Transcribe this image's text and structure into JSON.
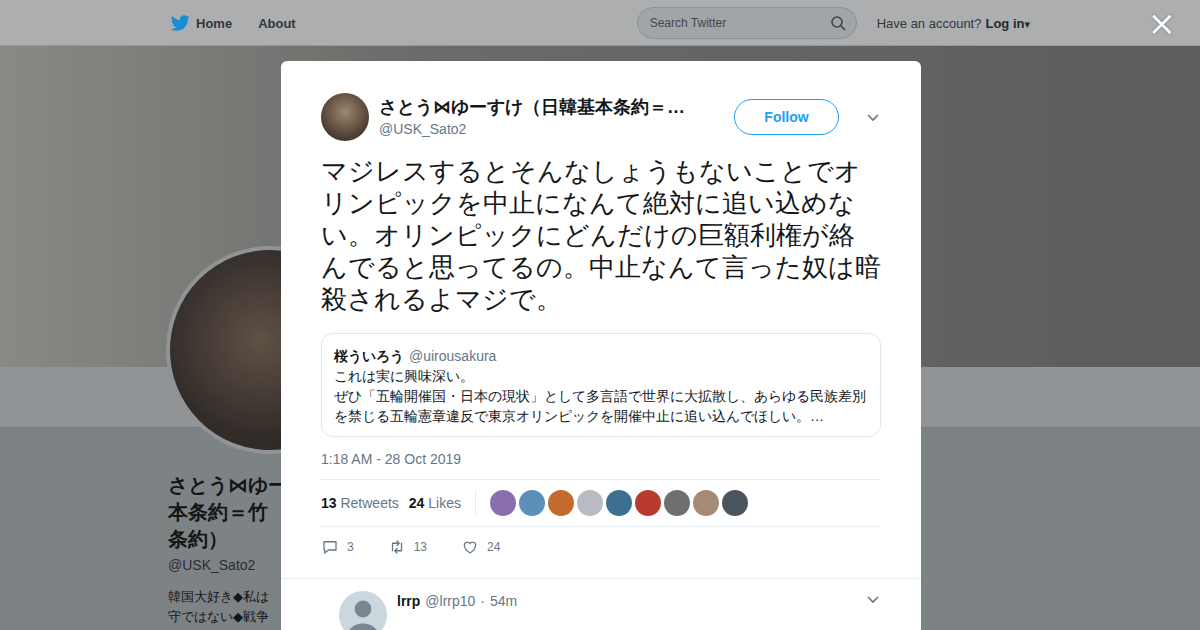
{
  "nav": {
    "home": "Home",
    "about": "About",
    "search_placeholder": "Search Twitter",
    "account_prompt": "Have an account?",
    "login": "Log in",
    "login_caret": "▾"
  },
  "close": "×",
  "profile": {
    "name_lines": [
      "さとう⋈ゆー",
      "本条約＝竹",
      "条約）"
    ],
    "handle": "@USK_Sato2",
    "bio_lines": [
      "韓国大好き◆私は",
      "守ではない◆戦争"
    ]
  },
  "tweet": {
    "name": "さとう⋈ゆーすけ（日韓基本条約＝…",
    "handle": "@USK_Sato2",
    "follow": "Follow",
    "text": "マジレスするとそんなしょうもないことでオリンピックを中止になんて絶対に追い込めない。オリンピックにどんだけの巨額利権が絡んでると思ってるの。中止なんて言った奴は暗殺されるよマジで。",
    "quote": {
      "name": "桜ういろう",
      "handle": "@uirousakura",
      "lines": [
        "これは実に興味深い。",
        "ぜひ「五輪開催国・日本の現状」として多言語で世界に大拡散し、あらゆる民族差別を禁じる五輪憲章違反で東京オリンピックを開催中止に追い込んでほしい。…"
      ]
    },
    "time": "1:18 AM - 28 Oct 2019",
    "retweets": {
      "count": "13",
      "label": "Retweets"
    },
    "likes": {
      "count": "24",
      "label": "Likes"
    },
    "likers": [
      {
        "color": "#8a6fb0"
      },
      {
        "color": "#5d90b8"
      },
      {
        "color": "#c46a2c"
      },
      {
        "color": "#b8bcc2"
      },
      {
        "color": "#3d6f91"
      },
      {
        "color": "#b83a2e"
      },
      {
        "color": "#6f6f6f"
      },
      {
        "color": "#a58a78"
      },
      {
        "color": "#4a5560"
      }
    ],
    "actions": [
      {
        "kind": "reply",
        "count": "3"
      },
      {
        "kind": "retweet",
        "count": "13"
      },
      {
        "kind": "like",
        "count": "24"
      }
    ]
  },
  "replies": [
    {
      "name": "lrrp",
      "handle": "@lrrp10",
      "separator": "·",
      "time": "54m"
    }
  ]
}
